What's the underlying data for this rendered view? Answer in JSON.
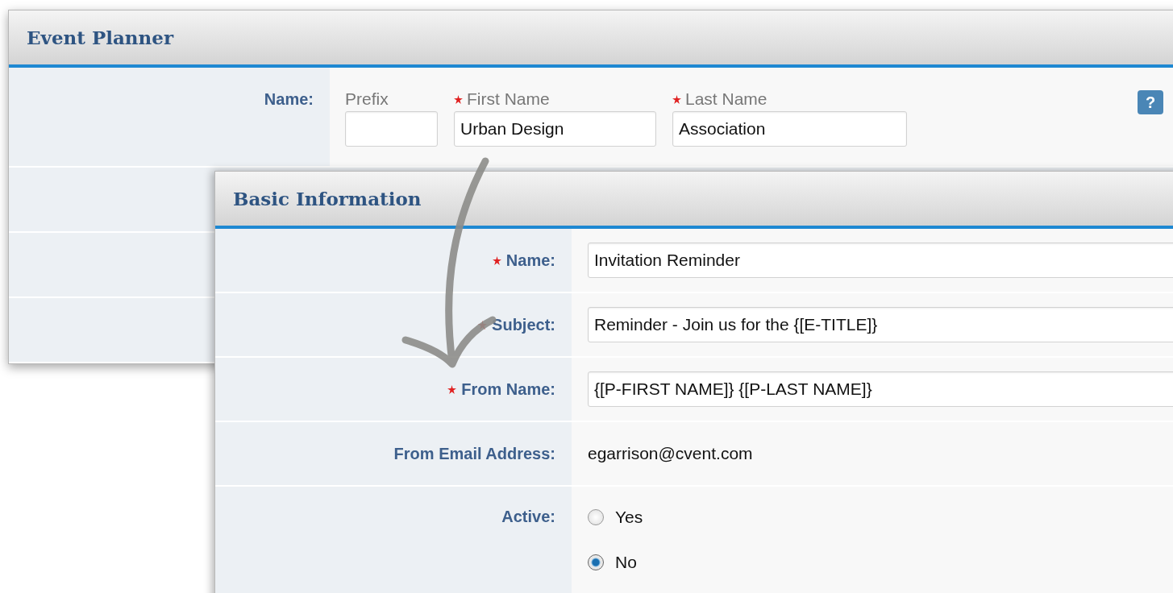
{
  "back_panel": {
    "title": "Event Planner",
    "name_label": "Name:",
    "fields": [
      {
        "label": "Prefix",
        "required": false
      },
      {
        "label": "First Name",
        "required": true,
        "value": "Urban Design"
      },
      {
        "label": "Last Name",
        "required": true,
        "value": "Association"
      }
    ],
    "help": "?"
  },
  "front_panel": {
    "title": "Basic Information",
    "rows": [
      {
        "kind": "input",
        "label": "Name:",
        "required": true,
        "value": "Invitation Reminder"
      },
      {
        "kind": "input",
        "label": "Subject:",
        "required": true,
        "value": "Reminder - Join us for the {[E-TITLE]}"
      },
      {
        "kind": "input",
        "label": "From Name:",
        "required": true,
        "value": "{[P-FIRST NAME]} {[P-LAST NAME]}"
      },
      {
        "kind": "text",
        "label": "From Email Address:",
        "required": false,
        "value": "egarrison@cvent.com"
      },
      {
        "kind": "radio",
        "label": "Active:",
        "required": false,
        "options": [
          {
            "label": "Yes",
            "selected": false
          },
          {
            "label": "No",
            "selected": true
          }
        ]
      }
    ]
  }
}
